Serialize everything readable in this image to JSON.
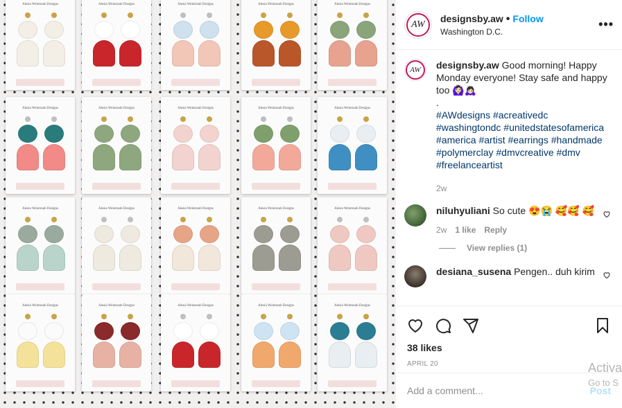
{
  "post": {
    "username": "designsby.aw",
    "follow_label": "Follow",
    "location": "Washington D.C.",
    "avatar_text": "AW",
    "more_glyph": "•••",
    "caption": "Good morning! Happy Monday everyone! Stay safe and happy too 🙆🏻‍♀️🙇🏻‍♀️",
    "caption_dot": ".",
    "hashtags": "#AWdesigns #acreativedc #washingtondc #unitedstatesofamerica #america #artist #earrings #handmade #polymerclay #dmvcreative #dmv #freelanceartist",
    "caption_age": "2w",
    "photo_card_brand": "Alesia Weintraub Designs"
  },
  "comments": [
    {
      "username": "niluhyuliani",
      "text": "So cute 😍😭 🥰🥰 🥰",
      "age": "2w",
      "likes": "1 like",
      "reply_label": "Reply",
      "view_replies": "View replies (1)"
    },
    {
      "username": "desiana_susena",
      "text": "Pengen.. duh kirim"
    }
  ],
  "actions": {
    "likes": "38 likes",
    "date": "APRIL 20"
  },
  "add_comment": {
    "placeholder": "Add a comment...",
    "post_label": "Post"
  },
  "watermark": {
    "line1": "Activa",
    "line2": "Go to S"
  },
  "icons": [
    "more-icon",
    "heart-icon",
    "comment-icon",
    "share-icon",
    "bookmark-icon"
  ],
  "colors": {
    "link": "#0095f6",
    "hashtag": "#00376b",
    "muted": "#8e8e8e"
  }
}
